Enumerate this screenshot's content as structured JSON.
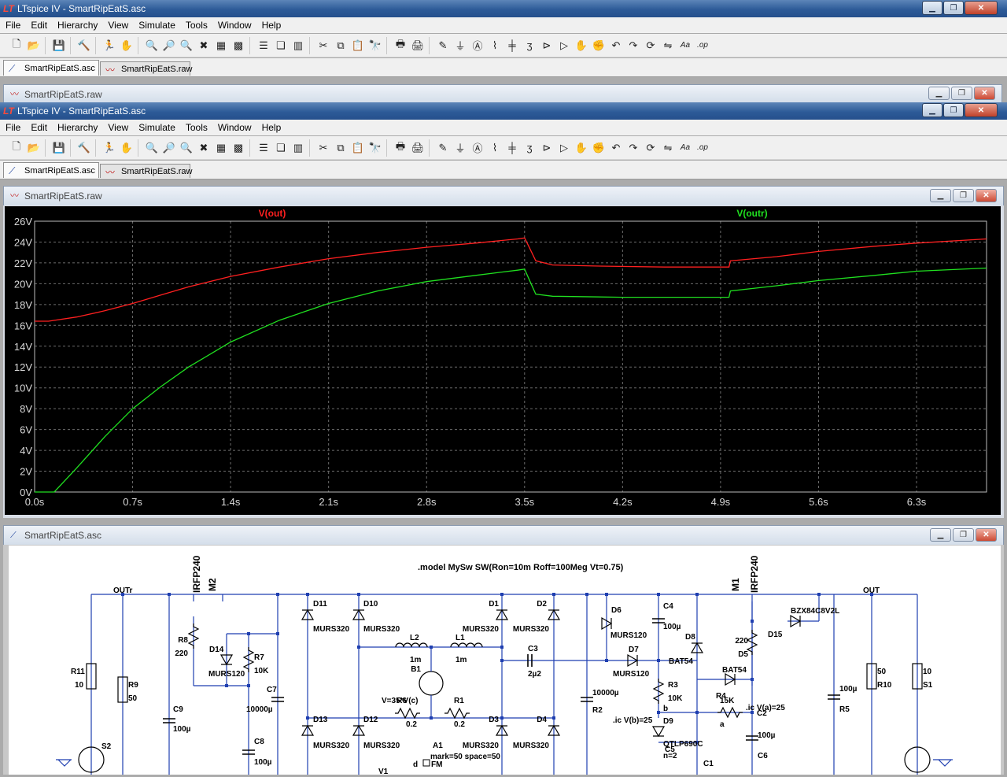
{
  "app": {
    "title": "LTspice IV - SmartRipEatS.asc",
    "menus": [
      "File",
      "Edit",
      "Hierarchy",
      "View",
      "Simulate",
      "Tools",
      "Window",
      "Help"
    ],
    "tabs": [
      "SmartRipEatS.asc",
      "SmartRipEatS.raw"
    ],
    "window_buttons": [
      "minimize",
      "restore",
      "close"
    ]
  },
  "minimized_child": {
    "title": "SmartRipEatS.raw"
  },
  "inner_app": {
    "title": "LTspice IV - SmartRipEatS.asc",
    "menus": [
      "File",
      "Edit",
      "Hierarchy",
      "View",
      "Simulate",
      "Tools",
      "Window",
      "Help"
    ],
    "tabs": [
      "SmartRipEatS.asc",
      "SmartRipEatS.raw"
    ]
  },
  "toolbar_icons": [
    "new-schematic-icon",
    "open-icon",
    "save-icon",
    "control-panel-icon",
    "run-icon",
    "halt-icon",
    "zoom-in-icon",
    "pan-icon",
    "zoom-out-icon",
    "zoom-fit-icon",
    "autorange-icon",
    "grid-icon",
    "tile-horizontal-icon",
    "cascade-icon",
    "tile-vertical-icon",
    "cut-icon",
    "copy-icon",
    "paste-icon",
    "find-icon",
    "print-preview-icon",
    "print-icon",
    "draw-wire-icon",
    "ground-icon",
    "label-net-icon",
    "resistor-icon",
    "capacitor-icon",
    "inductor-icon",
    "diode-icon",
    "component-icon",
    "move-icon",
    "drag-icon",
    "undo-icon",
    "redo-icon",
    "rotate-icon",
    "mirror-icon",
    "text-icon",
    "spice-directive-icon"
  ],
  "waveform_window": {
    "title": "SmartRipEatS.raw"
  },
  "schematic_window": {
    "title": "SmartRipEatS.asc"
  },
  "chart_data": {
    "type": "line",
    "background": "#000000",
    "grid": true,
    "xlim": [
      0,
      6.8
    ],
    "ylim": [
      0,
      26
    ],
    "x_ticks": [
      "0.0s",
      "0.7s",
      "1.4s",
      "2.1s",
      "2.8s",
      "3.5s",
      "4.2s",
      "4.9s",
      "5.6s",
      "6.3s"
    ],
    "y_ticks": [
      "0V",
      "2V",
      "4V",
      "6V",
      "8V",
      "10V",
      "12V",
      "14V",
      "16V",
      "18V",
      "20V",
      "22V",
      "24V",
      "26V"
    ],
    "series": [
      {
        "name": "V(out)",
        "color": "#ff2020",
        "points": [
          [
            0,
            16.4
          ],
          [
            0.1,
            16.4
          ],
          [
            0.3,
            16.8
          ],
          [
            0.5,
            17.4
          ],
          [
            0.7,
            18.1
          ],
          [
            0.9,
            18.9
          ],
          [
            1.1,
            19.7
          ],
          [
            1.4,
            20.7
          ],
          [
            1.75,
            21.6
          ],
          [
            2.1,
            22.4
          ],
          [
            2.45,
            23.0
          ],
          [
            2.8,
            23.5
          ],
          [
            3.15,
            23.9
          ],
          [
            3.45,
            24.3
          ],
          [
            3.5,
            24.4
          ],
          [
            3.53,
            23.6
          ],
          [
            3.58,
            22.2
          ],
          [
            3.7,
            21.8
          ],
          [
            4.0,
            21.7
          ],
          [
            4.5,
            21.6
          ],
          [
            4.96,
            21.6
          ],
          [
            4.97,
            22.2
          ],
          [
            5.3,
            22.6
          ],
          [
            5.6,
            23.1
          ],
          [
            6.0,
            23.6
          ],
          [
            6.3,
            23.9
          ],
          [
            6.8,
            24.3
          ]
        ]
      },
      {
        "name": "V(outr)",
        "color": "#20e020",
        "points": [
          [
            0,
            0
          ],
          [
            0.14,
            0
          ],
          [
            0.3,
            2.3
          ],
          [
            0.5,
            5.3
          ],
          [
            0.7,
            8.0
          ],
          [
            0.9,
            10.1
          ],
          [
            1.1,
            12.0
          ],
          [
            1.4,
            14.4
          ],
          [
            1.75,
            16.5
          ],
          [
            2.1,
            18.1
          ],
          [
            2.45,
            19.3
          ],
          [
            2.8,
            20.2
          ],
          [
            3.15,
            20.8
          ],
          [
            3.45,
            21.3
          ],
          [
            3.5,
            21.4
          ],
          [
            3.53,
            20.5
          ],
          [
            3.58,
            19.0
          ],
          [
            3.7,
            18.8
          ],
          [
            4.2,
            18.7
          ],
          [
            4.96,
            18.7
          ],
          [
            4.97,
            19.3
          ],
          [
            5.3,
            19.8
          ],
          [
            5.6,
            20.3
          ],
          [
            6.0,
            20.8
          ],
          [
            6.3,
            21.2
          ],
          [
            6.8,
            21.5
          ]
        ]
      }
    ]
  },
  "schematic": {
    "directive": ".model MySw SW(Ron=10m Roff=100Meg Vt=0.75)",
    "nets": [
      "OUTr",
      "OUT"
    ],
    "labels": [
      "IRFP240",
      "M2",
      "M1",
      "IRFP240",
      "D11",
      "D10",
      "D1",
      "D2",
      "MURS320",
      "MURS320",
      "MURS320",
      "MURS320",
      "L2",
      "1m",
      "L1",
      "1m",
      "C3",
      "2µ2",
      "B1",
      "R1",
      "0.2",
      "R6",
      "0.2",
      "V=35*V(c)",
      "D13",
      "D12",
      "D3",
      "D4",
      "MURS320",
      "MURS320",
      "MURS320",
      "MURS320",
      "A1",
      "mark=50 space=50",
      "V1",
      "d",
      "FM",
      "R8",
      "220",
      "D14",
      "MURS120",
      "R7",
      "10K",
      "C7",
      "10000µ",
      "C9",
      "100µ",
      "C8",
      "100µ",
      "R11",
      "10",
      "R9",
      "50",
      "S2",
      "D6",
      "MURS120",
      "C4",
      "100µ",
      "D8",
      "BAT54",
      "D7",
      "MURS120",
      "R3",
      "10K",
      "b",
      "D9",
      ".ic V(b)=25",
      "QTLP690C",
      "n=2",
      "C5",
      "C1",
      "10000µ",
      "R2",
      "220",
      "D5",
      "BZX84C8V2L",
      "D15",
      "BAT54",
      "R4",
      "15K",
      "a",
      ".ic V(a)=25",
      "C2",
      "100µ",
      "C6",
      "100µ",
      "R5",
      "50",
      "R10",
      "10",
      "S1"
    ]
  }
}
